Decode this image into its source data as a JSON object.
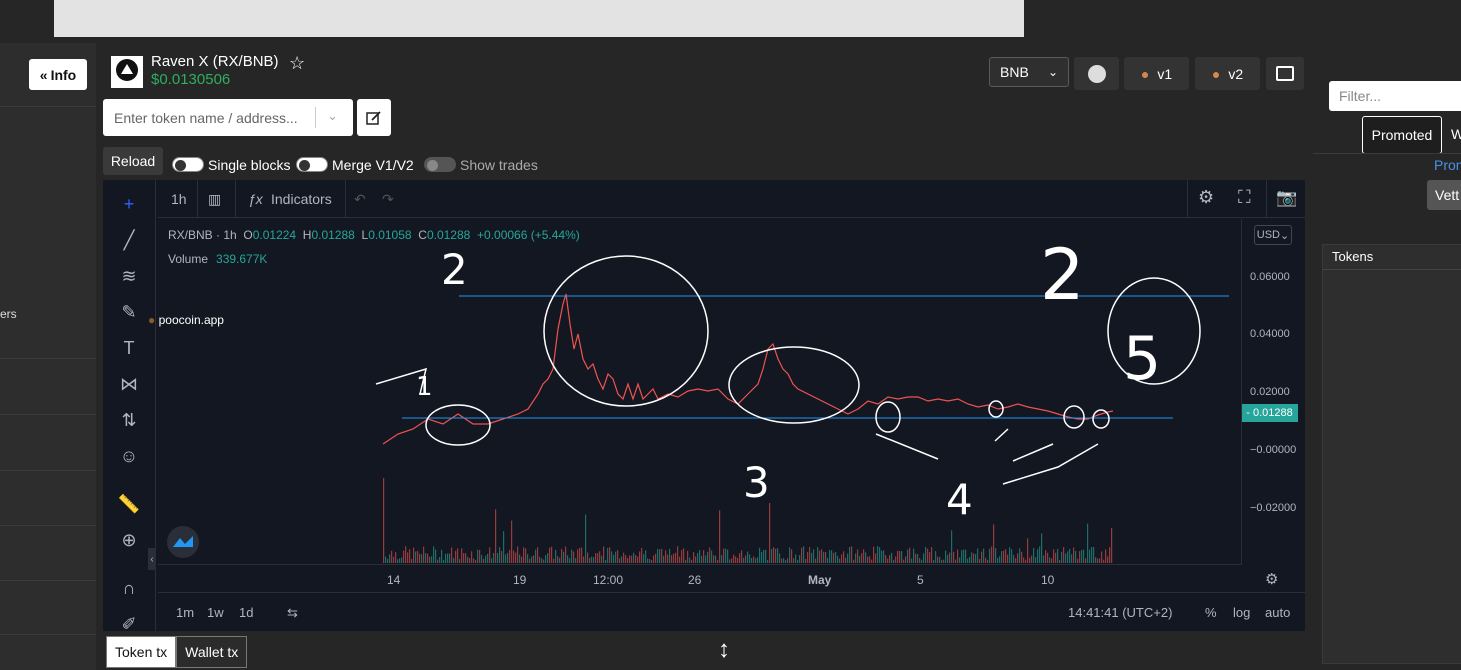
{
  "left_panel": {
    "info_button": "Info",
    "partial_label": "ers"
  },
  "token": {
    "name": "Raven X (RX/BNB)",
    "price": "$0.0130506"
  },
  "header": {
    "network_select": "BNB",
    "v1_label": "v1",
    "v2_label": "v2"
  },
  "search": {
    "placeholder": "Enter token name / address..."
  },
  "options": {
    "reload": "Reload",
    "single_blocks": "Single blocks",
    "merge": "Merge V1/V2",
    "show_trades": "Show trades"
  },
  "chart_toolbar": {
    "interval": "1h",
    "indicators": "Indicators"
  },
  "legend": {
    "symbol": "RX/BNB · 1h",
    "o_label": "O",
    "o": "0.01224",
    "h_label": "H",
    "h": "0.01288",
    "l_label": "L",
    "l": "0.01058",
    "c_label": "C",
    "c": "0.01288",
    "change": "+0.00066 (+5.44%)",
    "volume_label": "Volume",
    "volume": "339.677K"
  },
  "currency_badge": "USD",
  "watermark": "poocoin.app",
  "chart_data": {
    "type": "line",
    "y_ticks": [
      "0.06000",
      "0.04000",
      "0.02000",
      "−0.00000",
      "−0.02000"
    ],
    "x_ticks": [
      "14",
      "19",
      "12:00",
      "26",
      "May",
      "5",
      "10"
    ],
    "last_price": "0.01288",
    "annotations": [
      "1",
      "2",
      "3",
      "4",
      "5",
      "2"
    ]
  },
  "bottom_bar": {
    "ranges": [
      "1m",
      "1w",
      "1d"
    ],
    "time": "14:41:41 (UTC+2)",
    "percent": "%",
    "log": "log",
    "auto": "auto"
  },
  "tabs": {
    "token_tx": "Token tx",
    "wallet_tx": "Wallet tx"
  },
  "right_panel": {
    "filter_placeholder": "Filter...",
    "promoted": "Promoted",
    "partial_w": "W",
    "partial_prom": "Pron",
    "vetted": "Vett",
    "tokens_header": "Tokens"
  },
  "colors": {
    "up": "#26a69a",
    "down": "#ef5350",
    "line": "#2196f3",
    "price_green": "#2fae60"
  }
}
